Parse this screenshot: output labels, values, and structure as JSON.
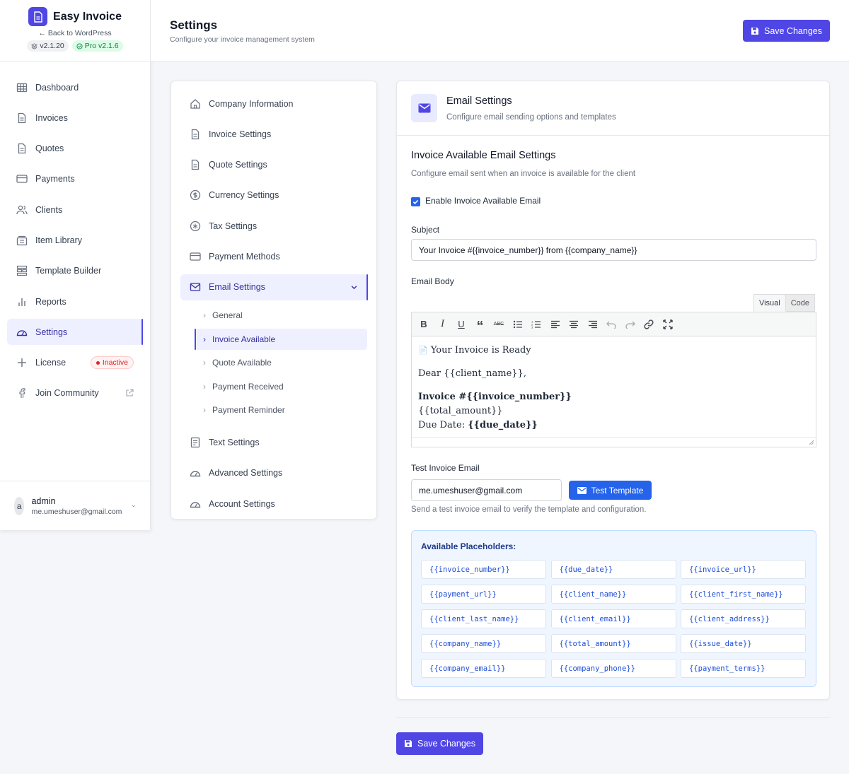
{
  "brand": {
    "title": "Easy Invoice",
    "back_link": "Back to WordPress",
    "version_core": "v2.1.20",
    "version_pro": "Pro v2.1.6"
  },
  "sidebar": {
    "items": [
      {
        "label": "Dashboard",
        "icon": "grid-icon"
      },
      {
        "label": "Invoices",
        "icon": "document-icon"
      },
      {
        "label": "Quotes",
        "icon": "document-icon"
      },
      {
        "label": "Payments",
        "icon": "credit-card-icon"
      },
      {
        "label": "Clients",
        "icon": "users-icon"
      },
      {
        "label": "Item Library",
        "icon": "library-icon"
      },
      {
        "label": "Template Builder",
        "icon": "template-icon"
      },
      {
        "label": "Reports",
        "icon": "bar-chart-icon"
      },
      {
        "label": "Settings",
        "icon": "gauge-icon",
        "active": true
      },
      {
        "label": "License",
        "icon": "plus-icon",
        "badge": "Inactive"
      },
      {
        "label": "Join Community",
        "icon": "facebook-icon",
        "external": true
      }
    ]
  },
  "user": {
    "initial": "a",
    "name": "admin",
    "email": "me.umeshuser@gmail.com"
  },
  "header": {
    "title": "Settings",
    "subtitle": "Configure your invoice management system",
    "save_label": "Save Changes"
  },
  "settings_menu": {
    "items": [
      {
        "label": "Company Information",
        "icon": "home-icon"
      },
      {
        "label": "Invoice Settings",
        "icon": "document-icon"
      },
      {
        "label": "Quote Settings",
        "icon": "document-icon"
      },
      {
        "label": "Currency Settings",
        "icon": "dollar-icon"
      },
      {
        "label": "Tax Settings",
        "icon": "asterisk-icon"
      },
      {
        "label": "Payment Methods",
        "icon": "credit-card-icon"
      },
      {
        "label": "Email Settings",
        "icon": "mail-icon",
        "active": true
      }
    ],
    "email_sub": [
      "General",
      "Invoice Available",
      "Quote Available",
      "Payment Received",
      "Payment Reminder"
    ],
    "after_items": [
      {
        "label": "Text Settings",
        "icon": "text-doc-icon"
      },
      {
        "label": "Advanced Settings",
        "icon": "gauge-icon"
      },
      {
        "label": "Account Settings",
        "icon": "gauge-icon"
      }
    ]
  },
  "panel": {
    "title": "Email Settings",
    "subtitle": "Configure email sending options and templates",
    "section_title": "Invoice Available Email Settings",
    "section_sub": "Configure email sent when an invoice is available for the client",
    "enable_label": "Enable Invoice Available Email",
    "subject_label": "Subject",
    "subject_value": "Your Invoice #{{invoice_number}} from {{company_name}}",
    "body_label": "Email Body",
    "tab_visual": "Visual",
    "tab_code": "Code",
    "body": {
      "heading": "Your Invoice is Ready",
      "greeting": "Dear {{client_name}},",
      "invoice_prefix": "Invoice #",
      "invoice_var": "{{invoice_number}}",
      "total": "{{total_amount}}",
      "due_prefix": "Due Date: ",
      "due_var": "{{due_date}}"
    },
    "test_label": "Test Invoice Email",
    "test_value": "me.umeshuser@gmail.com",
    "test_button": "Test Template",
    "test_help": "Send a test invoice email to verify the template and configuration.",
    "placeholders_title": "Available Placeholders:",
    "placeholders": [
      "{{invoice_number}}",
      "{{due_date}}",
      "{{invoice_url}}",
      "{{payment_url}}",
      "{{client_name}}",
      "{{client_first_name}}",
      "{{client_last_name}}",
      "{{client_email}}",
      "{{client_address}}",
      "{{company_name}}",
      "{{total_amount}}",
      "{{issue_date}}",
      "{{company_email}}",
      "{{company_phone}}",
      "{{payment_terms}}"
    ]
  },
  "footer": {
    "save_label": "Save Changes"
  },
  "colors": {
    "primary": "#4f46e5",
    "blue": "#2563eb",
    "active_bg": "#eef0ff",
    "inactive_red": "#dc2626"
  }
}
